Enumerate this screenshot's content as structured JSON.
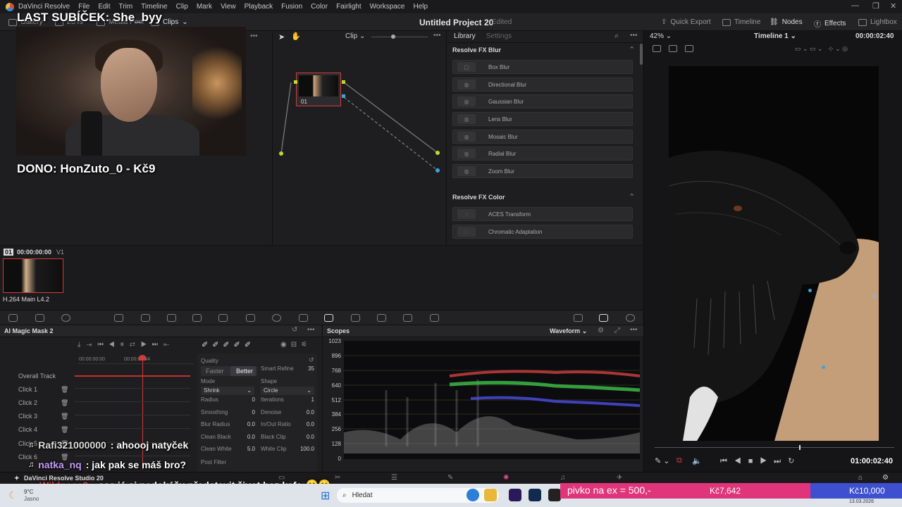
{
  "menubar": {
    "app_name": "DaVinci Resolve",
    "items": [
      "File",
      "Edit",
      "Trim",
      "Timeline",
      "Clip",
      "Mark",
      "View",
      "Playback",
      "Fusion",
      "Color",
      "Fairlight",
      "Workspace",
      "Help"
    ]
  },
  "toolbar": {
    "gallery": "Gallery",
    "luts": "LUTs",
    "media_pool": "Media Pool",
    "clips": "Clips",
    "project_title": "Untitled Project 20",
    "project_status": "Edited",
    "quick_export": "Quick Export",
    "timeline": "Timeline",
    "nodes": "Nodes",
    "effects": "Effects",
    "lightbox": "Lightbox"
  },
  "stream_overlay": {
    "last_sub": "LAST SUBÍČEK: She_byy",
    "dono": "DONO: HonZuto_0 - Kč9"
  },
  "node_editor": {
    "mode": "Clip",
    "node_label": "01"
  },
  "library": {
    "tab_library": "Library",
    "tab_settings": "Settings",
    "section_blur": "Resolve FX Blur",
    "blur_items": [
      "Box Blur",
      "Directional Blur",
      "Gaussian Blur",
      "Lens Blur",
      "Mosaic Blur",
      "Radial Blur",
      "Zoom Blur"
    ],
    "section_color": "Resolve FX Color",
    "color_items": [
      "ACES Transform",
      "Chromatic Adaptation"
    ]
  },
  "viewer": {
    "zoom": "42%",
    "timeline_name": "Timeline 1",
    "timecode_top": "00:00:02:40",
    "timecode_bottom": "01:00:02:40"
  },
  "clips": {
    "clip_number": "01",
    "clip_timecode": "00:00:00:00",
    "clip_track": "V1",
    "clip_codec": "H.264 Main L4.2"
  },
  "magic_mask": {
    "title": "AI Magic Mask 2",
    "ruler_start": "00:00:00:00",
    "ruler_mid": "00:00:02:44",
    "tracks": [
      "Overall Track",
      "Click 1",
      "Click 2",
      "Click 3",
      "Click 4",
      "Click 5",
      "Click 6"
    ],
    "quality_label": "Quality",
    "faster": "Faster",
    "better": "Better",
    "smart_refine_label": "Smart Refine",
    "smart_refine_value": "35",
    "mode_label": "Mode",
    "mode_value": "Shrink",
    "shape_label": "Shape",
    "shape_value": "Circle",
    "params_left": [
      {
        "label": "Radius",
        "value": "0"
      },
      {
        "label": "Smoothing",
        "value": "0"
      },
      {
        "label": "Blur Radius",
        "value": "0.0"
      },
      {
        "label": "Clean Black",
        "value": "0.0"
      },
      {
        "label": "Clean White",
        "value": "5.0"
      }
    ],
    "params_right": [
      {
        "label": "Iterations",
        "value": "1"
      },
      {
        "label": "Denoise",
        "value": "0.0"
      },
      {
        "label": "In/Out Ratio",
        "value": "0.0"
      },
      {
        "label": "Black Clip",
        "value": "0.0"
      },
      {
        "label": "White Clip",
        "value": "100.0"
      }
    ],
    "post_filter": "Post Filter"
  },
  "scopes": {
    "title": "Scopes",
    "mode": "Waveform",
    "ticks": [
      "1023",
      "896",
      "768",
      "640",
      "512",
      "384",
      "256",
      "128",
      "0"
    ]
  },
  "pagebar": {
    "app_version": "DaVinci Resolve Studio 20"
  },
  "chat": [
    {
      "user": "Rafi321000000",
      "message": ": ahoooj natyček"
    },
    {
      "user": "natka_nq",
      "message": ": jak pak se máš bro?"
    },
    {
      "user": "Wildness2",
      "message": ": eee já si nedokážu představit život bez kafe"
    }
  ],
  "donation_bar": {
    "goal_text": "pivko na ex = 500,-",
    "current": "Kč7,642",
    "target": "Kč10,000"
  },
  "taskbar": {
    "weather_temp": "9°C",
    "weather_desc": "Jasno",
    "search_placeholder": "Hledat",
    "date": "13.03.2026"
  },
  "colors": {
    "accent_red": "#d23b3b",
    "donation_pink": "#e0357a",
    "donation_blue": "#3e4fd0",
    "waveform_red": "#d24040",
    "waveform_green": "#3fc24a",
    "waveform_blue": "#4a4ad8"
  }
}
